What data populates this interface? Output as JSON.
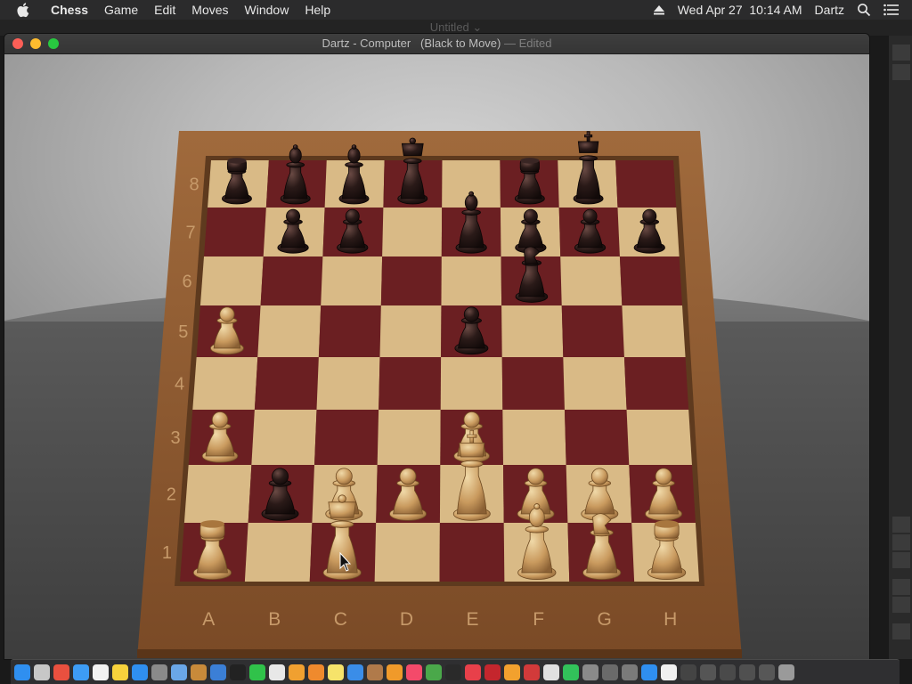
{
  "menubar": {
    "app_name": "Chess",
    "items": [
      "Game",
      "Edit",
      "Moves",
      "Window",
      "Help"
    ],
    "clock": "Wed Apr 27  10:14 AM",
    "user": "Dartz"
  },
  "background_window": {
    "title": "Untitled ⌄"
  },
  "window": {
    "title": "Dartz - Computer   (Black to Move)",
    "edited": "— Edited"
  },
  "board": {
    "files": [
      "A",
      "B",
      "C",
      "D",
      "E",
      "F",
      "G",
      "H"
    ],
    "ranks": [
      "8",
      "7",
      "6",
      "5",
      "4",
      "3",
      "2",
      "1"
    ],
    "dark_square_color": "#6b1f22",
    "light_square_color": "#d9ba86",
    "frame_color": "#8a5a33",
    "pieces": [
      {
        "square": "a8",
        "color": "black",
        "type": "rook"
      },
      {
        "square": "b8",
        "color": "black",
        "type": "bishop"
      },
      {
        "square": "c8",
        "color": "black",
        "type": "bishop"
      },
      {
        "square": "d8",
        "color": "black",
        "type": "queen"
      },
      {
        "square": "f8",
        "color": "black",
        "type": "rook"
      },
      {
        "square": "g8",
        "color": "black",
        "type": "king"
      },
      {
        "square": "b7",
        "color": "black",
        "type": "pawn"
      },
      {
        "square": "c7",
        "color": "black",
        "type": "pawn"
      },
      {
        "square": "e7",
        "color": "black",
        "type": "bishop"
      },
      {
        "square": "f7",
        "color": "black",
        "type": "pawn"
      },
      {
        "square": "g7",
        "color": "black",
        "type": "pawn"
      },
      {
        "square": "h7",
        "color": "black",
        "type": "pawn"
      },
      {
        "square": "f6",
        "color": "black",
        "type": "knight"
      },
      {
        "square": "e5",
        "color": "black",
        "type": "pawn"
      },
      {
        "square": "b2",
        "color": "black",
        "type": "pawn"
      },
      {
        "square": "a5",
        "color": "white",
        "type": "pawn"
      },
      {
        "square": "a3",
        "color": "white",
        "type": "pawn"
      },
      {
        "square": "e3",
        "color": "white",
        "type": "pawn"
      },
      {
        "square": "c2",
        "color": "white",
        "type": "pawn"
      },
      {
        "square": "d2",
        "color": "white",
        "type": "pawn"
      },
      {
        "square": "e2",
        "color": "white",
        "type": "king"
      },
      {
        "square": "f2",
        "color": "white",
        "type": "pawn"
      },
      {
        "square": "g2",
        "color": "white",
        "type": "pawn"
      },
      {
        "square": "h2",
        "color": "white",
        "type": "pawn"
      },
      {
        "square": "a1",
        "color": "white",
        "type": "rook"
      },
      {
        "square": "c1",
        "color": "white",
        "type": "queen"
      },
      {
        "square": "f1",
        "color": "white",
        "type": "bishop"
      },
      {
        "square": "g1",
        "color": "white",
        "type": "knight"
      },
      {
        "square": "h1",
        "color": "white",
        "type": "rook"
      }
    ]
  },
  "dock": {
    "icons": [
      "finder-icon",
      "launchpad-icon",
      "chrome-icon",
      "safari-icon",
      "calendar-icon",
      "notes-icon",
      "app-store-icon",
      "system-preferences-icon",
      "preview-icon",
      "books-icon",
      "xcode-icon",
      "terminal-icon",
      "messages-icon",
      "files-icon",
      "photos-icon",
      "ibooks-icon",
      "notes2-icon",
      "mail-icon",
      "contacts-icon",
      "pages-icon",
      "music-icon",
      "maps-icon",
      "activity-icon",
      "stop-icon",
      "cherry-icon",
      "home-icon",
      "photo-booth-icon",
      "chess-icon",
      "facetime-icon",
      "automator-icon",
      "tools-icon",
      "disk-icon",
      "app-store2-icon",
      "document-icon",
      "window1-icon",
      "window2-icon",
      "window3-icon",
      "window4-icon",
      "window5-icon",
      "trash-icon"
    ],
    "colors": [
      "#2f8ff0",
      "#c7c7c7",
      "#e9503f",
      "#3d9cf5",
      "#f2f2f2",
      "#f7d23c",
      "#2f8ff0",
      "#8a8a8a",
      "#6aa7e8",
      "#c88a3a",
      "#3b7fd6",
      "#222222",
      "#30c24a",
      "#e8e8e8",
      "#f0a030",
      "#ef8a2d",
      "#f6e36a",
      "#3a8de8",
      "#b07a4a",
      "#f09a2a",
      "#f44a6a",
      "#4aa84a",
      "#2a2a2a",
      "#e8404a",
      "#c4262d",
      "#f2a12e",
      "#d23a3a",
      "#e0e0e0",
      "#32c25a",
      "#8a8a8a",
      "#6a6a6a",
      "#7a7a7a",
      "#2f8ff0",
      "#f0f0f0",
      "#444444",
      "#555555",
      "#4a4a4a",
      "#505050",
      "#575757",
      "#9a9a9a"
    ]
  }
}
